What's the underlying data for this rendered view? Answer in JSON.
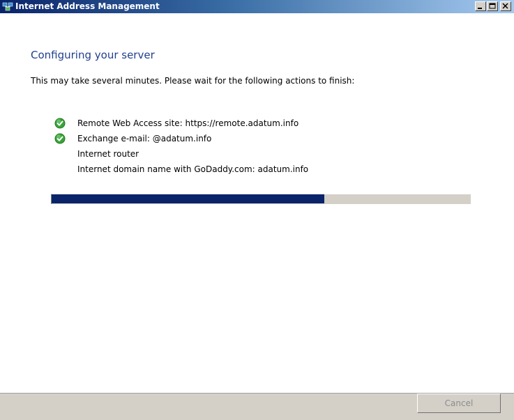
{
  "window": {
    "title": "Internet Address Management"
  },
  "wizard": {
    "heading": "Configuring your server",
    "subtitle": "This may take several minutes. Please wait for the following actions to finish:",
    "tasks": [
      {
        "label": "Remote Web Access site: https://remote.adatum.info",
        "status": "complete"
      },
      {
        "label": "Exchange e-mail: @adatum.info",
        "status": "complete"
      },
      {
        "label": "Internet router",
        "status": "pending"
      },
      {
        "label": "Internet domain name with GoDaddy.com: adatum.info",
        "status": "pending"
      }
    ],
    "progress_percent": 65
  },
  "footer": {
    "cancel_label": "Cancel"
  },
  "colors": {
    "heading": "#1f3f8f",
    "progress_fill": "#0a246a",
    "check_green": "#3aa33a"
  }
}
